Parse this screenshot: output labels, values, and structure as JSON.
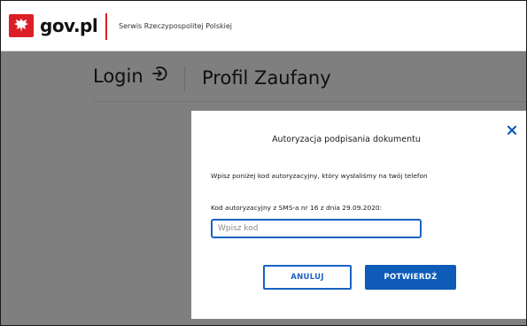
{
  "header": {
    "brand": "gov.pl",
    "service": "Serwis Rzeczypospolitej Polskiej"
  },
  "page": {
    "login_label": "Login",
    "profile_title": "Profil Zaufany"
  },
  "modal": {
    "title": "Autoryzacja podpisania dokumentu",
    "info": "Wpisz poniżej kod autoryzacyjny, który wysłaliśmy na twój telefon",
    "code_label": "Kod autoryzacyjny z SMS-a nr 16 z dnia 29.09.2020:",
    "code_placeholder": "Wpisz kod",
    "code_value": "",
    "cancel_label": "ANULUJ",
    "confirm_label": "POTWIERDŹ"
  },
  "icons": {
    "emblem": "polish-eagle-icon",
    "login": "login-arrow-icon",
    "close": "close-icon"
  },
  "colors": {
    "brand_red": "#dc1f26",
    "primary_blue": "#0e5bb8",
    "overlay": "#7f7f7f"
  }
}
